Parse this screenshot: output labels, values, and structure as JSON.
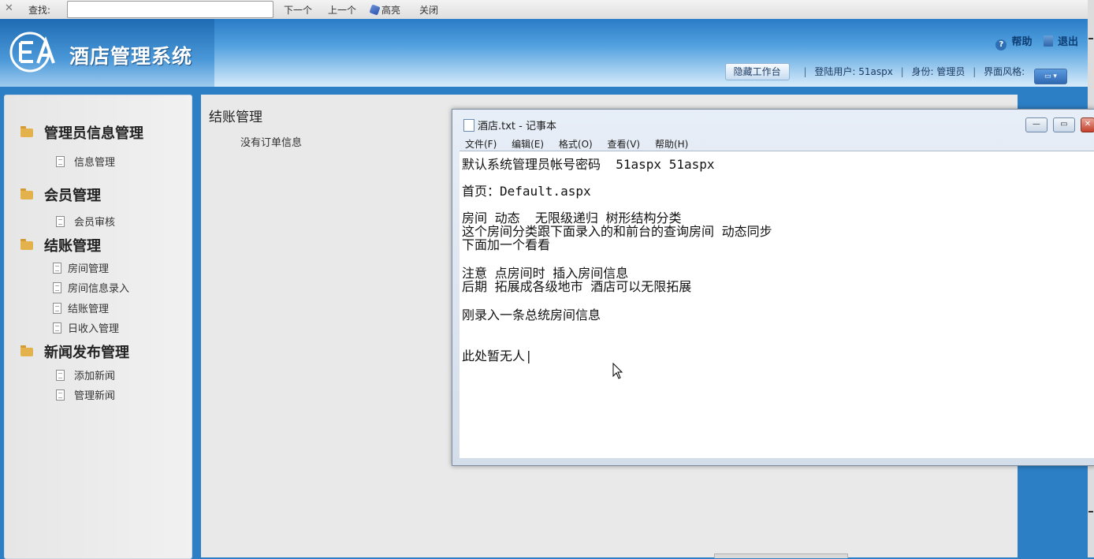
{
  "findbar": {
    "close_glyph": "✕",
    "label": "查找:",
    "input_value": "",
    "next": "下一个",
    "prev": "上一个",
    "highlight": "高亮",
    "close": "关闭"
  },
  "header": {
    "app_title": "酒店管理系统",
    "logo_text": "EA",
    "help": "帮助",
    "logout": "退出",
    "hide_workspace": "隐藏工作台",
    "login_user_label": "登陆用户:",
    "login_user": "51aspx",
    "role_label": "身份:",
    "role": "管理员",
    "theme_label": "界面风格:"
  },
  "sidebar": {
    "groups": [
      {
        "label": "管理员信息管理",
        "items": [
          "信息管理"
        ]
      },
      {
        "label": "会员管理",
        "items": [
          "会员审核"
        ]
      },
      {
        "label": "结账管理",
        "items": [
          "房间管理",
          "房间信息录入",
          "结账管理",
          "日收入管理"
        ]
      },
      {
        "label": "新闻发布管理",
        "items": [
          "添加新闻",
          "管理新闻"
        ]
      }
    ]
  },
  "main": {
    "title": "结账管理",
    "empty_text": "没有订单信息"
  },
  "notepad": {
    "title": "酒店.txt - 记事本",
    "menu": [
      "文件(F)",
      "编辑(E)",
      "格式(O)",
      "查看(V)",
      "帮助(H)"
    ],
    "lines": [
      "默认系统管理员帐号密码  51aspx 51aspx",
      "首页：Default.aspx",
      "房间 动态  无限级递归 树形结构分类",
      "这个房间分类跟下面录入的和前台的查询房间 动态同步",
      "下面加一个看看",
      "注意 点房间时 插入房间信息",
      "后期 拓展成各级地市 酒店可以无限拓展",
      "刚录入一条总统房间信息",
      "此处暂无人|"
    ]
  },
  "colors": {
    "header_top": "#2a7cc7",
    "page_bg": "#2c7fc5",
    "sidebar_bg": "#ececec",
    "folder": "#e4b24d"
  }
}
